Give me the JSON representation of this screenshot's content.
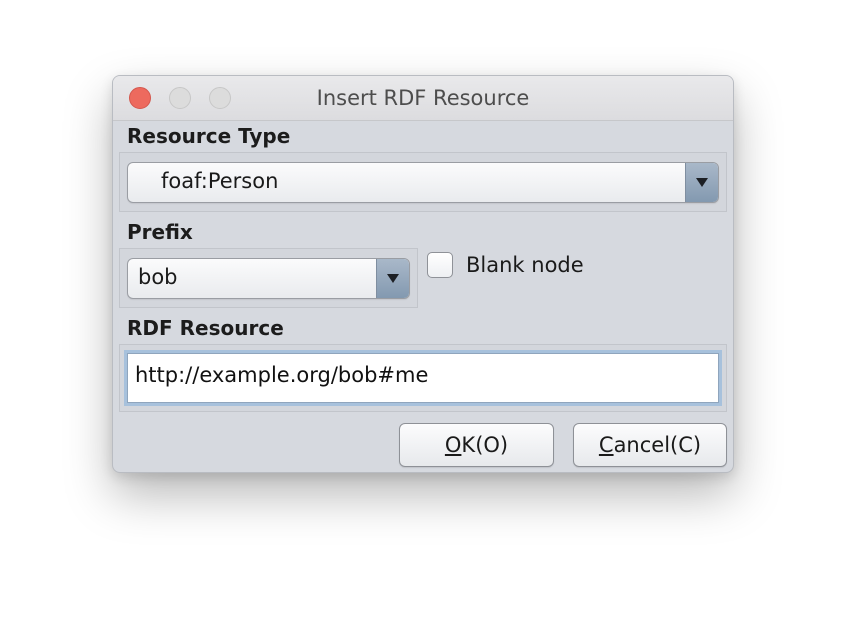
{
  "window": {
    "title": "Insert RDF Resource",
    "controls": [
      "close",
      "minimize",
      "zoom"
    ]
  },
  "resource_type": {
    "label": "Resource Type",
    "selected": "foaf:Person"
  },
  "prefix": {
    "label": "Prefix",
    "selected": "bob",
    "blank_node": {
      "label": "Blank node",
      "checked": false
    }
  },
  "rdf_resource": {
    "label": "RDF Resource",
    "value": "http://example.org/bob#me"
  },
  "buttons": {
    "ok": {
      "mnemonic": "O",
      "rest": "K(O)"
    },
    "cancel": {
      "mnemonic": "C",
      "rest": "ancel(C)"
    }
  },
  "colors": {
    "close_button": "#ed6a5e",
    "combo_arrow": "#8399b0",
    "focus_ring": "#a7c1dc",
    "dialog_background": "#d6d9df"
  }
}
